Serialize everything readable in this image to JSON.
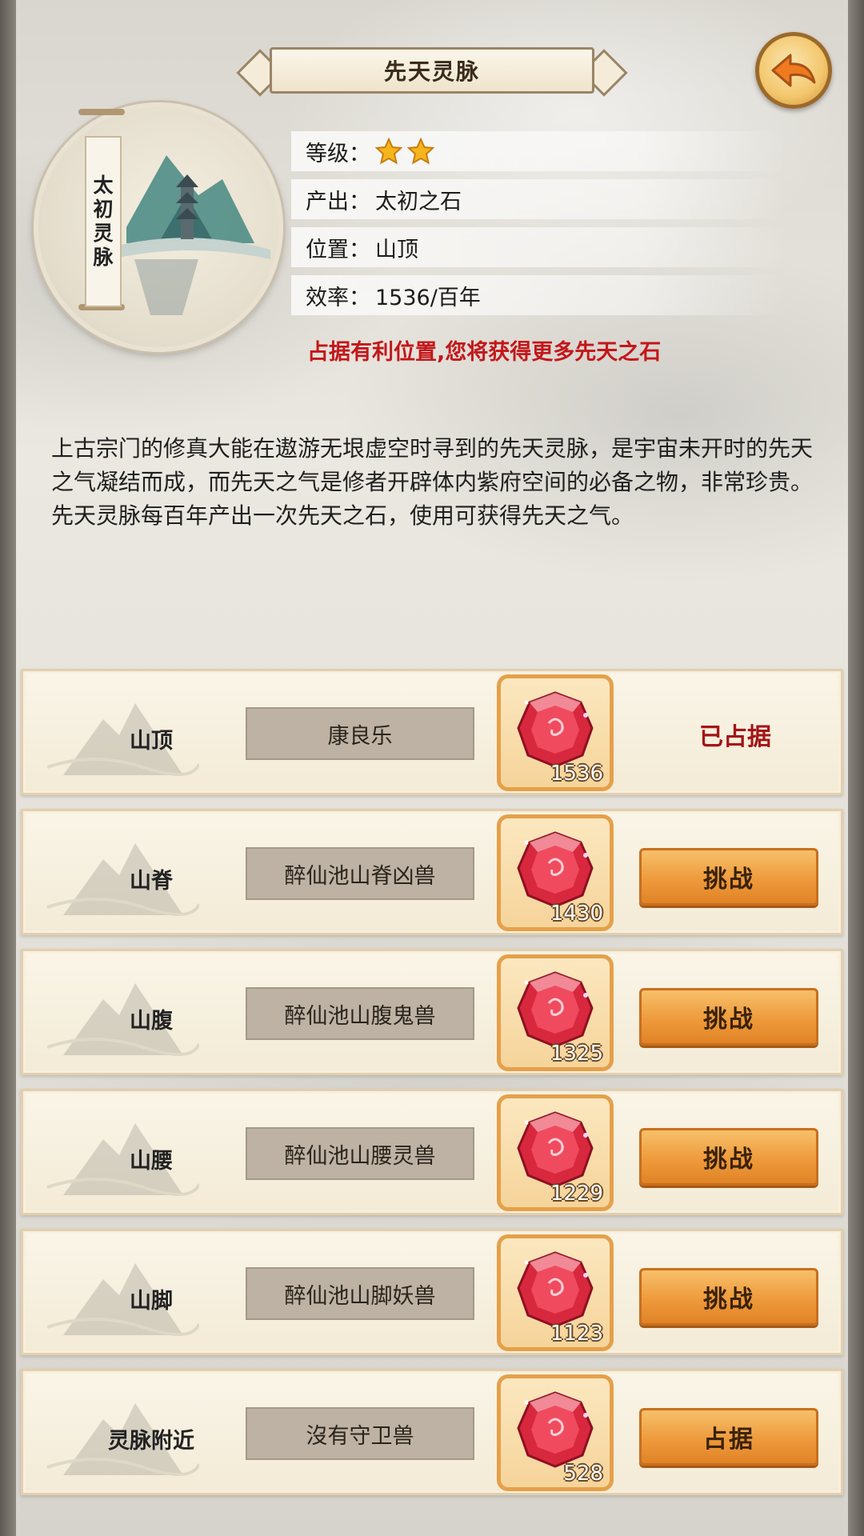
{
  "header": {
    "title": "先天灵脉"
  },
  "medallion": {
    "label_chars": [
      "太",
      "初",
      "灵",
      "脉"
    ]
  },
  "info": {
    "level_label": "等级：",
    "level_stars": 2,
    "output_label": "产出：",
    "output_value": "太初之石",
    "position_label": "位置：",
    "position_value": "山顶",
    "efficiency_label": "效率：",
    "efficiency_value": "1536/百年",
    "promo": "占据有利位置,您将获得更多先天之石"
  },
  "description": "上古宗门的修真大能在遨游无垠虚空时寻到的先天灵脉，是宇宙未开时的先天之气凝结而成，而先天之气是修者开辟体内紫府空间的必备之物，非常珍贵。先天灵脉每百年产出一次先天之石，使用可获得先天之气。",
  "slots": [
    {
      "location": "山顶",
      "guard": "康良乐",
      "gem_count": "1536",
      "status": "已占据"
    },
    {
      "location": "山脊",
      "guard": "醉仙池山脊凶兽",
      "gem_count": "1430",
      "action": "挑战"
    },
    {
      "location": "山腹",
      "guard": "醉仙池山腹鬼兽",
      "gem_count": "1325",
      "action": "挑战"
    },
    {
      "location": "山腰",
      "guard": "醉仙池山腰灵兽",
      "gem_count": "1229",
      "action": "挑战"
    },
    {
      "location": "山脚",
      "guard": "醉仙池山脚妖兽",
      "gem_count": "1123",
      "action": "挑战"
    },
    {
      "location": "灵脉附近",
      "guard": "沒有守卫兽",
      "gem_count": "528",
      "action": "占据"
    }
  ],
  "colors": {
    "accent_red": "#c3171a",
    "button_orange": "#ee9a3c",
    "gem_red": "#d8283e"
  },
  "icons": {
    "back": "back-arrow-icon",
    "star": "star-icon",
    "gem": "red-gem-icon"
  }
}
